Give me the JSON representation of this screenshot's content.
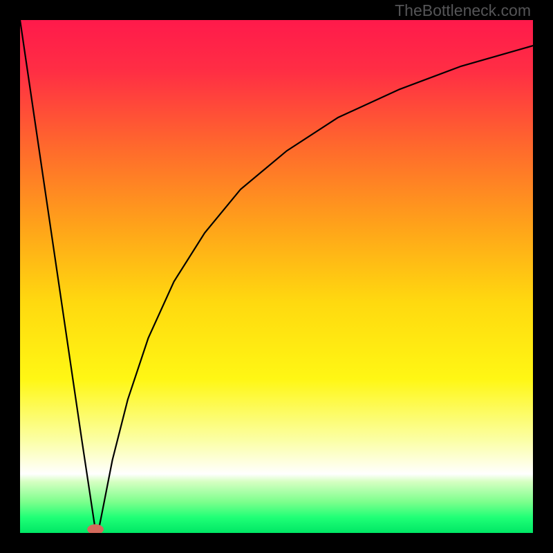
{
  "watermark": "TheBottleneck.com",
  "chart_data": {
    "type": "line",
    "title": "",
    "xlabel": "",
    "ylabel": "",
    "xlim": [
      0,
      100
    ],
    "ylim": [
      0,
      100
    ],
    "grid": false,
    "series": [
      {
        "name": "curve",
        "x": [
          0,
          3,
          6,
          9,
          12,
          14.7,
          15,
          15.3,
          16,
          18,
          21,
          25,
          30,
          36,
          43,
          52,
          62,
          74,
          86,
          100
        ],
        "y": [
          100,
          79.6,
          59.2,
          38.8,
          18.4,
          0.5,
          0,
          0.5,
          4,
          14.2,
          26,
          38,
          49,
          58.5,
          67,
          74.5,
          81,
          86.5,
          91,
          95
        ]
      }
    ],
    "gradient_stops": [
      {
        "offset": 0.0,
        "color": "#ff1a4b"
      },
      {
        "offset": 0.1,
        "color": "#ff2e44"
      },
      {
        "offset": 0.25,
        "color": "#ff6a2c"
      },
      {
        "offset": 0.4,
        "color": "#ffa21a"
      },
      {
        "offset": 0.55,
        "color": "#ffd90f"
      },
      {
        "offset": 0.7,
        "color": "#fff714"
      },
      {
        "offset": 0.82,
        "color": "#fbffa6"
      },
      {
        "offset": 0.885,
        "color": "#ffffff"
      },
      {
        "offset": 0.9,
        "color": "#d6ffc2"
      },
      {
        "offset": 0.94,
        "color": "#7bff8c"
      },
      {
        "offset": 0.97,
        "color": "#1fff76"
      },
      {
        "offset": 1.0,
        "color": "#00e765"
      }
    ],
    "marker": {
      "x": 14.7,
      "y": 0.7,
      "rx": 1.6,
      "ry": 1.0,
      "color": "#d46a5c"
    }
  }
}
